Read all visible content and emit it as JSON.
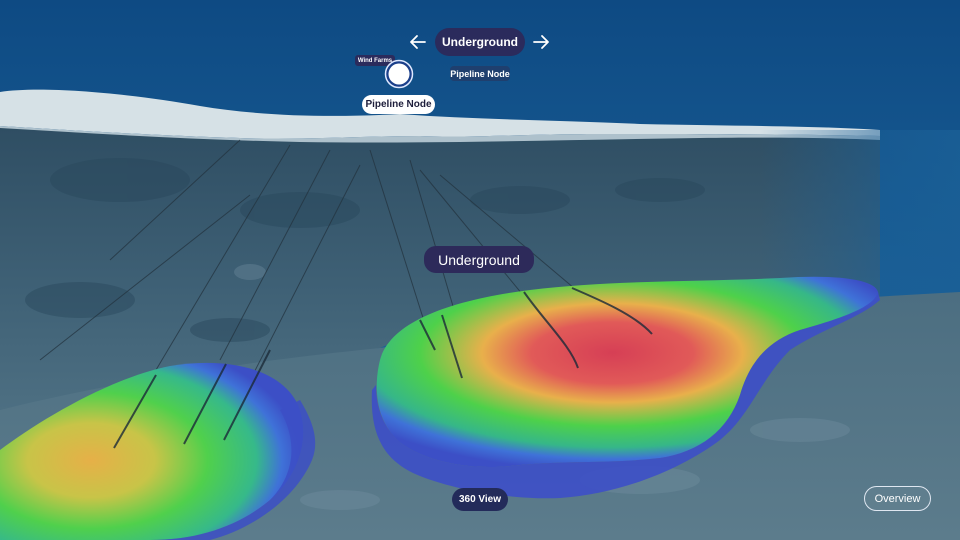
{
  "navigation": {
    "title": "Underground",
    "previous_icon": "arrow-left-icon",
    "next_icon": "arrow-right-icon",
    "secondary_label": "Pipeline Node"
  },
  "marker": {
    "layer_label": "Wind Farms",
    "node_label": "Pipeline Node"
  },
  "scene": {
    "underground_label": "Underground",
    "heatmap_colors": [
      "#e04a4a",
      "#e7b54a",
      "#4bd14a",
      "#4060e0"
    ],
    "water_color": "#0f4f86",
    "seabed_color": "#d8e2e7"
  },
  "controls": {
    "view360_label": "360 View",
    "overview_label": "Overview"
  }
}
